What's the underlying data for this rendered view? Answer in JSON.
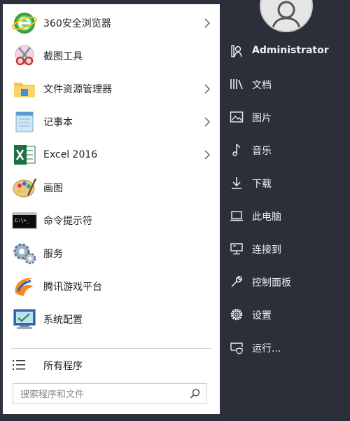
{
  "programs": [
    {
      "label": "360安全浏览器",
      "icon": "360-browser-icon",
      "has_arrow": true
    },
    {
      "label": "截图工具",
      "icon": "snipping-tool-icon",
      "has_arrow": false
    },
    {
      "label": "文件资源管理器",
      "icon": "folder-icon",
      "has_arrow": true
    },
    {
      "label": "记事本",
      "icon": "notepad-icon",
      "has_arrow": true
    },
    {
      "label": "Excel 2016",
      "icon": "excel-icon",
      "has_arrow": true
    },
    {
      "label": "画图",
      "icon": "paint-icon",
      "has_arrow": false
    },
    {
      "label": "命令提示符",
      "icon": "cmd-icon",
      "has_arrow": false
    },
    {
      "label": "服务",
      "icon": "services-gear-icon",
      "has_arrow": false
    },
    {
      "label": "腾讯游戏平台",
      "icon": "tencent-games-icon",
      "has_arrow": false
    },
    {
      "label": "系统配置",
      "icon": "system-config-icon",
      "has_arrow": false
    }
  ],
  "all_programs": {
    "label": "所有程序",
    "icon": "list-icon"
  },
  "search": {
    "placeholder": "搜索程序和文件",
    "icon": "search-icon"
  },
  "user": {
    "name": "Administrator",
    "icon": "user-icon"
  },
  "places": [
    {
      "label": "文档",
      "icon": "library-icon"
    },
    {
      "label": "图片",
      "icon": "picture-icon"
    },
    {
      "label": "音乐",
      "icon": "music-note-icon"
    },
    {
      "label": "下载",
      "icon": "download-icon"
    },
    {
      "label": "此电脑",
      "icon": "laptop-icon"
    },
    {
      "label": "连接到",
      "icon": "connect-monitor-icon"
    },
    {
      "label": "控制面板",
      "icon": "wrench-icon"
    },
    {
      "label": "设置",
      "icon": "gear-icon"
    },
    {
      "label": "运行...",
      "icon": "run-icon"
    }
  ],
  "colors": {
    "panel_bg": "#2b2f3a",
    "left_bg": "#ffffff",
    "text_light": "#eef0f3"
  }
}
